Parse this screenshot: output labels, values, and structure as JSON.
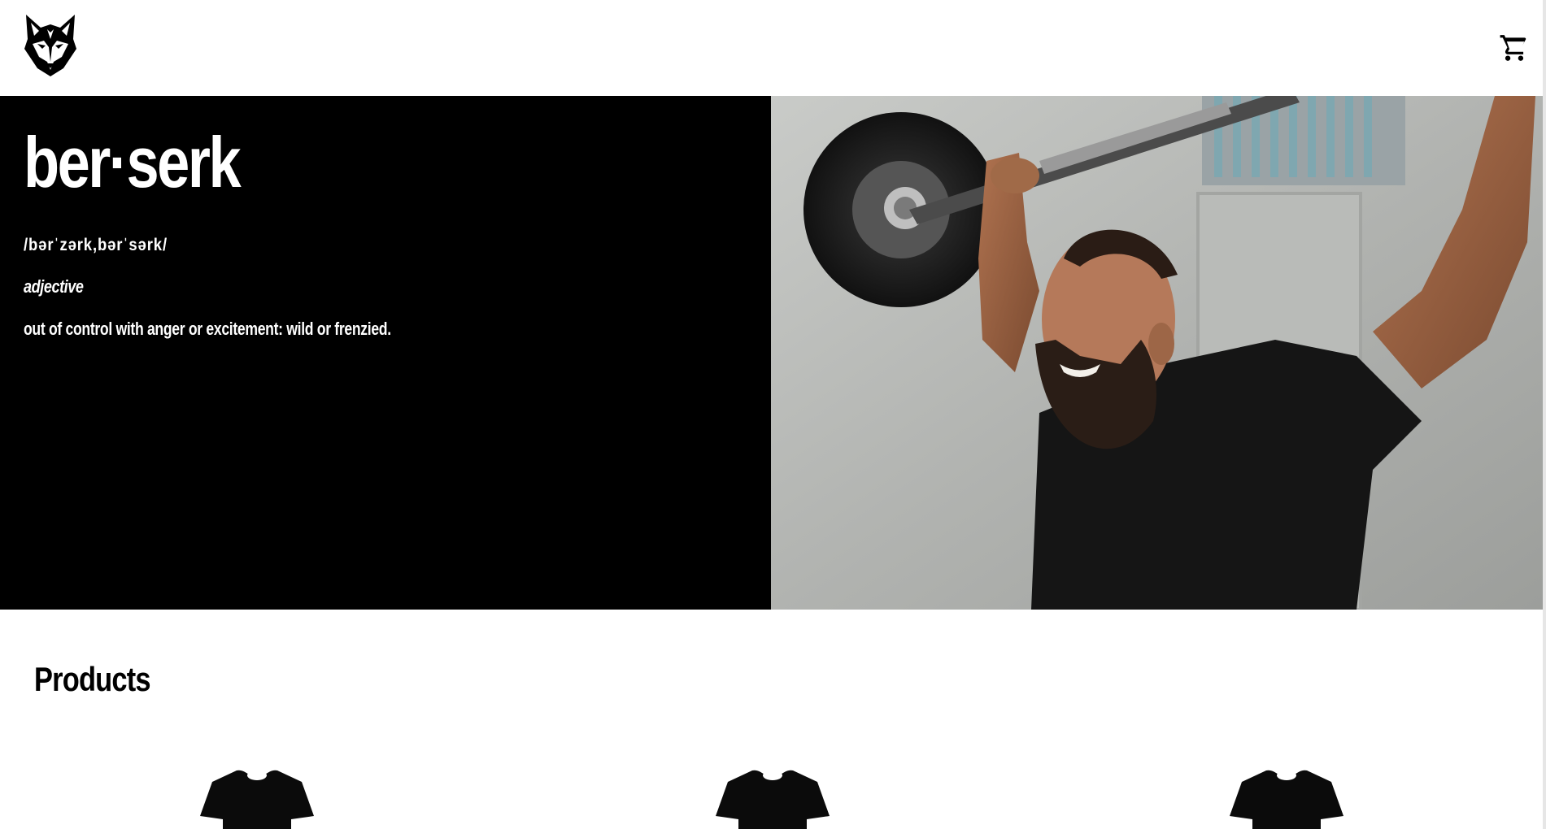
{
  "header": {
    "logo_icon": "wolf-head-logo-icon",
    "cart_icon": "shopping-cart-icon"
  },
  "hero": {
    "word": "ber·serk",
    "pronunciation": "/bərˈzərk,bərˈsərk/",
    "part_of_speech": "adjective",
    "definition": "out of control with anger or excitement: wild or frenzied.",
    "background_color": "#000000",
    "text_color": "#ffffff"
  },
  "products": {
    "heading": "Products",
    "items": [
      {
        "icon": "t-shirt-icon"
      },
      {
        "icon": "t-shirt-icon"
      },
      {
        "icon": "t-shirt-icon"
      }
    ]
  }
}
